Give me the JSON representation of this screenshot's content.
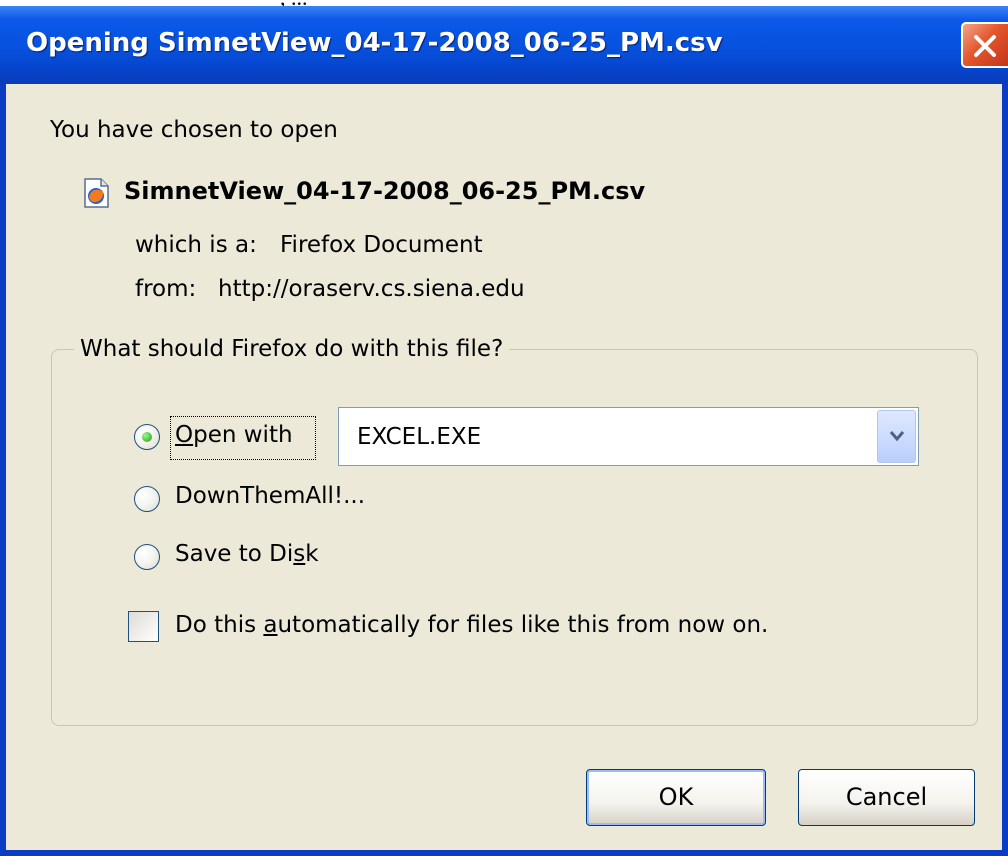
{
  "window": {
    "title": "Opening SimnetView_04-17-2008_06-25_PM.csv"
  },
  "intro_text": "You have chosen to open",
  "file": {
    "name": "SimnetView_04-17-2008_06-25_PM.csv",
    "type_label": "which is a:",
    "type_value": "Firefox Document",
    "from_label": "from:",
    "from_value": "http://oraserv.cs.siena.edu"
  },
  "group": {
    "legend": "What should Firefox do with this file?"
  },
  "options": {
    "open_with": {
      "pre": "",
      "key": "O",
      "post": "pen with",
      "selected": true
    },
    "application": {
      "value": "EXCEL.EXE"
    },
    "downthemall": {
      "label": "DownThemAll!...",
      "selected": false
    },
    "save_to_disk": {
      "pre": "Save to Di",
      "key": "s",
      "post": "k",
      "selected": false
    },
    "auto": {
      "pre": "Do this ",
      "key": "a",
      "post": "utomatically for files like this from now on.",
      "checked": false
    }
  },
  "buttons": {
    "ok": "OK",
    "cancel": "Cancel"
  },
  "colors": {
    "titlebar": "#0753df",
    "client": "#ece9d8",
    "close": "#e4562d"
  },
  "icons": [
    "close-icon",
    "firefox-document-icon",
    "chevron-down-icon"
  ]
}
